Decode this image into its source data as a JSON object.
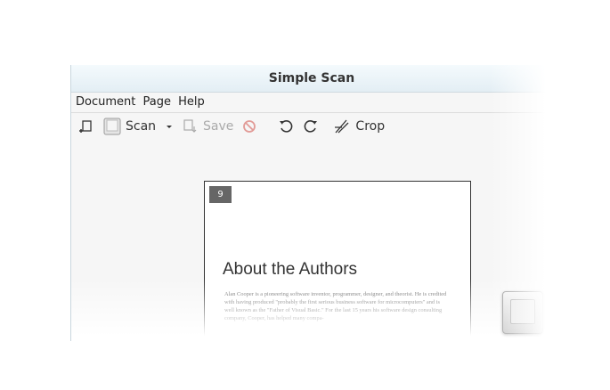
{
  "window": {
    "title": "Simple Scan"
  },
  "menu": [
    {
      "label": "Document"
    },
    {
      "label": "Page"
    },
    {
      "label": "Help"
    }
  ],
  "toolbar": {
    "scan_label": "Scan",
    "save_label": "Save",
    "crop_label": "Crop",
    "icons": [
      "new-document-icon",
      "scanner-icon",
      "dropdown-arrow-icon",
      "save-icon",
      "stop-icon",
      "rotate-left-icon",
      "rotate-right-icon",
      "crop-icon"
    ]
  },
  "page": {
    "badge": "9",
    "title": "About the Authors",
    "body": "Alan Cooper is a pioneering software inventor, programmer, designer, and theorist. He is credited with having produced \"probably the first serious business software for microcomputers\" and is well known as the \"Father of Visual Basic.\" For the last 15 years his software design consulting company, Cooper, has helped many compa-"
  },
  "colors": {
    "accent": "#333333",
    "disabled": "#aaaaaa",
    "stop": "#d9534f"
  }
}
